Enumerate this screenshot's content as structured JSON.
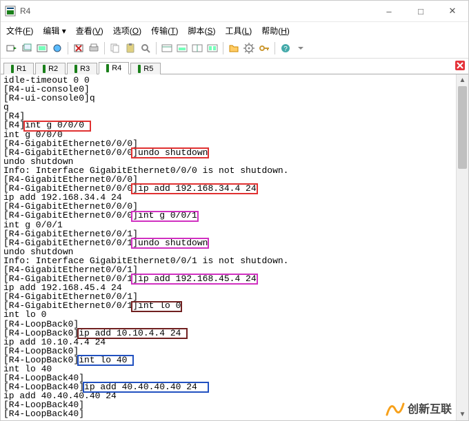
{
  "window": {
    "title": "R4"
  },
  "menu": [
    {
      "label": "文件",
      "accel": "F"
    },
    {
      "label": "编辑",
      "accel": ""
    },
    {
      "label": "查看",
      "accel": "V"
    },
    {
      "label": "选项",
      "accel": "O"
    },
    {
      "label": "传输",
      "accel": "T"
    },
    {
      "label": "脚本",
      "accel": "S"
    },
    {
      "label": "工具",
      "accel": "L"
    },
    {
      "label": "帮助",
      "accel": "H"
    }
  ],
  "tabs": {
    "active_index": 3,
    "items": [
      {
        "label": "R1"
      },
      {
        "label": "R2"
      },
      {
        "label": "R3"
      },
      {
        "label": "R4"
      },
      {
        "label": "R5"
      }
    ]
  },
  "terminal": {
    "lines": [
      "idle-timeout 0 0",
      "[R4-ui-console0]",
      "[R4-ui-console0]q",
      "q",
      "[R4]",
      "[R4]int g 0/0/0",
      "int g 0/0/0",
      "[R4-GigabitEthernet0/0/0]",
      "[R4-GigabitEthernet0/0/0]undo shutdown",
      "undo shutdown",
      "Info: Interface GigabitEthernet0/0/0 is not shutdown.",
      "[R4-GigabitEthernet0/0/0]",
      "[R4-GigabitEthernet0/0/0]ip add 192.168.34.4 24",
      "ip add 192.168.34.4 24",
      "[R4-GigabitEthernet0/0/0]",
      "[R4-GigabitEthernet0/0/0]int g 0/0/1",
      "int g 0/0/1",
      "[R4-GigabitEthernet0/0/1]",
      "[R4-GigabitEthernet0/0/1]undo shutdown",
      "undo shutdown",
      "Info: Interface GigabitEthernet0/0/1 is not shutdown.",
      "[R4-GigabitEthernet0/0/1]",
      "[R4-GigabitEthernet0/0/1]ip add 192.168.45.4 24",
      "ip add 192.168.45.4 24",
      "[R4-GigabitEthernet0/0/1]",
      "[R4-GigabitEthernet0/0/1]int lo 0",
      "int lo 0",
      "[R4-LoopBack0]",
      "[R4-LoopBack0]ip add 10.10.4.4 24",
      "ip add 10.10.4.4 24",
      "[R4-LoopBack0]",
      "[R4-LoopBack0]int lo 40",
      "int lo 40",
      "[R4-LoopBack40]",
      "[R4-LoopBack40]ip add 40.40.40.40 24",
      "ip add 40.40.40.40 24",
      "[R4-LoopBack40]",
      "[R4-LoopBack40]"
    ]
  },
  "highlights": [
    {
      "line": 5,
      "col_start": 4,
      "col_end": 16,
      "color": "#e03030"
    },
    {
      "line": 8,
      "col_start": 24,
      "col_end": 38,
      "color": "#e03030"
    },
    {
      "line": 12,
      "col_start": 24,
      "col_end": 47,
      "color": "#e03030"
    },
    {
      "line": 15,
      "col_start": 24,
      "col_end": 36,
      "color": "#d030c0"
    },
    {
      "line": 18,
      "col_start": 24,
      "col_end": 38,
      "color": "#d030c0"
    },
    {
      "line": 22,
      "col_start": 24,
      "col_end": 47,
      "color": "#d030c0"
    },
    {
      "line": 25,
      "col_start": 24,
      "col_end": 33,
      "color": "#702020"
    },
    {
      "line": 28,
      "col_start": 14,
      "col_end": 34,
      "color": "#702020"
    },
    {
      "line": 31,
      "col_start": 14,
      "col_end": 24,
      "color": "#2050c0"
    },
    {
      "line": 34,
      "col_start": 15,
      "col_end": 38,
      "color": "#2050c0"
    }
  ],
  "watermark": "创新互联",
  "colors": {
    "red": "#e03030",
    "magenta": "#d030c0",
    "maroon": "#702020",
    "blue": "#2050c0"
  }
}
